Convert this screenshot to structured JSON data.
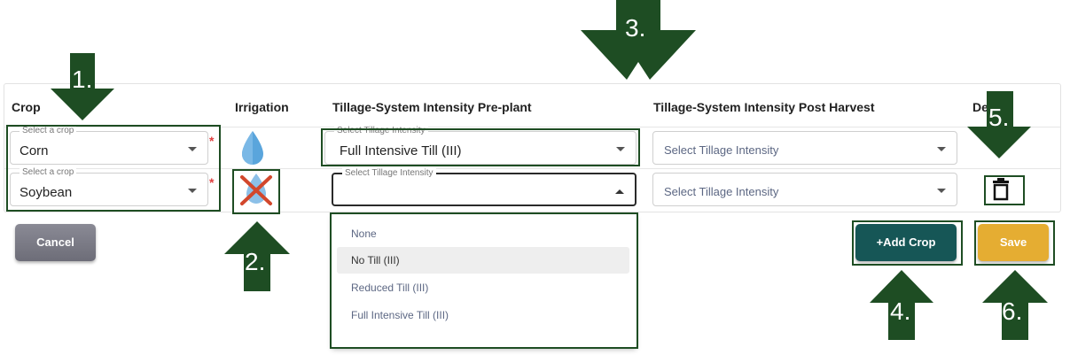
{
  "table": {
    "headers": {
      "crop": "Crop",
      "irrigation": "Irrigation",
      "tillage_pre": "Tillage-System Intensity Pre-plant",
      "tillage_post": "Tillage-System Intensity Post Harvest",
      "delete": "De"
    },
    "rows": [
      {
        "crop_legend": "Select a crop",
        "crop_value": "Corn",
        "required_mark": "*",
        "irrigation": "irrigated",
        "pre_legend": "Select Tillage Intensity",
        "pre_value": "Full Intensive Till (III)",
        "post_placeholder": "Select Tillage Intensity"
      },
      {
        "crop_legend": "Select a crop",
        "crop_value": "Soybean",
        "required_mark": "*",
        "irrigation": "not-irrigated",
        "pre_legend": "Select Tillage Intensity",
        "pre_value": "",
        "post_placeholder": "Select Tillage Intensity"
      }
    ]
  },
  "dropdown": {
    "options": [
      "None",
      "No Till (III)",
      "Reduced Till (III)",
      "Full Intensive Till (III)"
    ],
    "highlighted_index": 1
  },
  "buttons": {
    "cancel": "Cancel",
    "add_crop": "+Add Crop",
    "save": "Save"
  },
  "annotations": {
    "arrow_1": "1.",
    "arrow_2": "2.",
    "arrow_3": "3.",
    "arrow_4": "4.",
    "arrow_5": "5.",
    "arrow_6": "6."
  },
  "icons": {
    "irrigation_on": "water-drop-icon",
    "irrigation_off": "water-drop-crossed-icon",
    "delete": "trash-icon",
    "dropdown": "chevron-down-icon"
  },
  "colors": {
    "annotation_green": "#1e4d23",
    "add_button": "#165656",
    "save_button": "#e5ad32",
    "cancel_button": "#7a7a85",
    "drop_blue": "#5aa5dc",
    "cross_red": "#d2472c"
  }
}
